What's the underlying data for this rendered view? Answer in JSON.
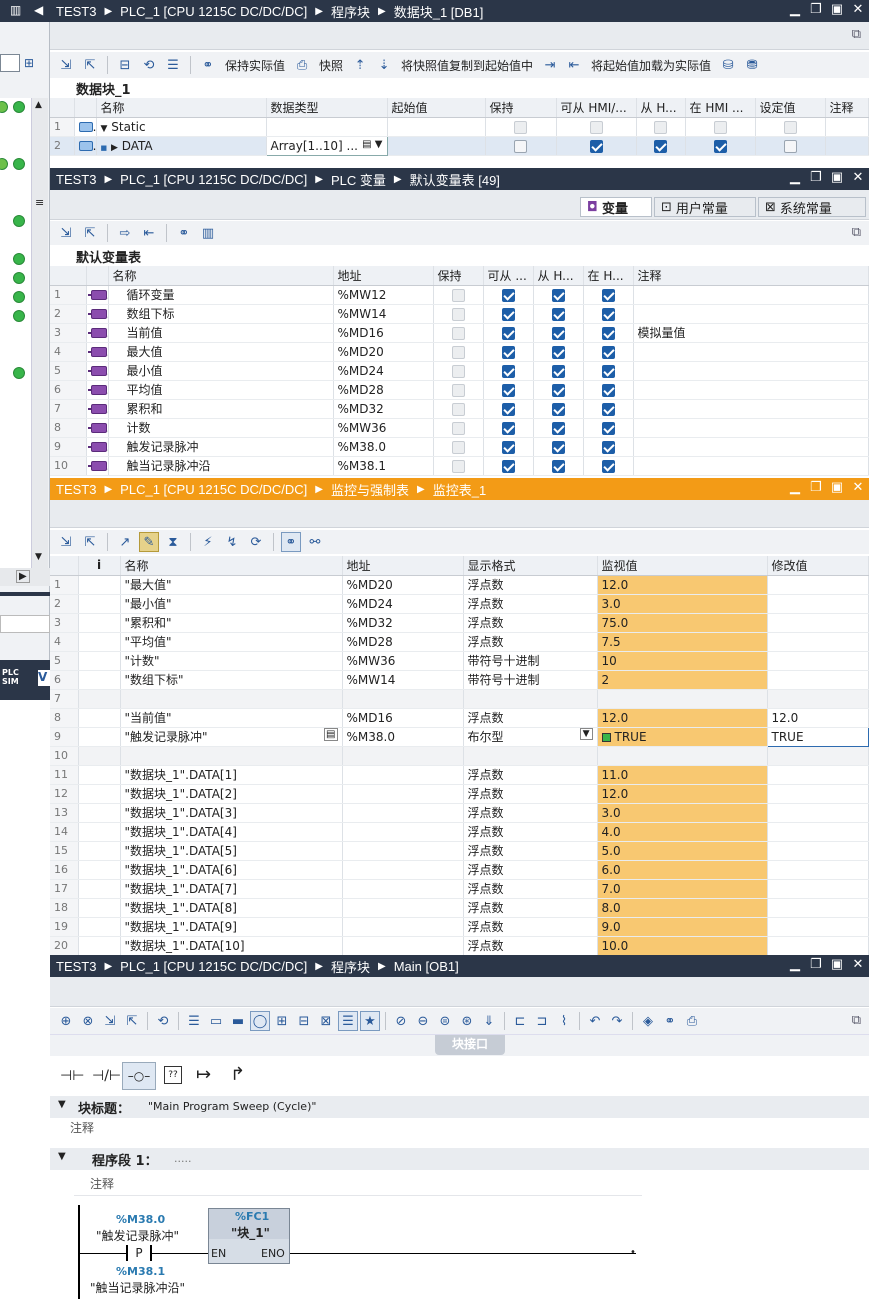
{
  "db_window": {
    "title": [
      "TEST3",
      "PLC_1 [CPU 1215C DC/DC/DC]",
      "程序块",
      "数据块_1 [DB1]"
    ],
    "toolbar": {
      "keep_actual": "保持实际值",
      "snapshot": "快照",
      "copy_snapshot": "将快照值复制到起始值中",
      "load_start": "将起始值加载为实际值"
    },
    "section": "数据块_1",
    "columns": [
      "名称",
      "数据类型",
      "起始值",
      "保持",
      "可从 HMI/...",
      "从 H...",
      "在 HMI ...",
      "设定值",
      "注释"
    ],
    "rows": [
      {
        "num": "1",
        "name": "Static",
        "type": "",
        "retain": false,
        "hmi": false,
        "from_h": false,
        "in_hmi": false,
        "setpoint": false,
        "dim": true
      },
      {
        "num": "2",
        "name": "DATA",
        "type": "Array[1..10] ...",
        "retain": false,
        "hmi": true,
        "from_h": true,
        "in_hmi": true,
        "setpoint": false,
        "dim": false
      }
    ]
  },
  "tag_window": {
    "title": [
      "TEST3",
      "PLC_1 [CPU 1215C DC/DC/DC]",
      "PLC 变量",
      "默认变量表 [49]"
    ],
    "tabs": [
      "变量",
      "用户常量",
      "系统常量"
    ],
    "section": "默认变量表",
    "columns": [
      "名称",
      "地址",
      "保持",
      "可从 ...",
      "从 H...",
      "在 H...",
      "注释"
    ],
    "rows": [
      {
        "num": "1",
        "name": "循环变量",
        "addr": "%MW12",
        "comment": ""
      },
      {
        "num": "2",
        "name": "数组下标",
        "addr": "%MW14",
        "comment": ""
      },
      {
        "num": "3",
        "name": "当前值",
        "addr": "%MD16",
        "comment": "模拟量值"
      },
      {
        "num": "4",
        "name": "最大值",
        "addr": "%MD20",
        "comment": ""
      },
      {
        "num": "5",
        "name": "最小值",
        "addr": "%MD24",
        "comment": ""
      },
      {
        "num": "6",
        "name": "平均值",
        "addr": "%MD28",
        "comment": ""
      },
      {
        "num": "7",
        "name": "累积和",
        "addr": "%MD32",
        "comment": ""
      },
      {
        "num": "8",
        "name": "计数",
        "addr": "%MW36",
        "comment": ""
      },
      {
        "num": "9",
        "name": "触发记录脉冲",
        "addr": "%M38.0",
        "comment": ""
      },
      {
        "num": "10",
        "name": "触当记录脉冲沿",
        "addr": "%M38.1",
        "comment": ""
      }
    ]
  },
  "watch_window": {
    "title": [
      "TEST3",
      "PLC_1 [CPU 1215C DC/DC/DC]",
      "监控与强制表",
      "监控表_1"
    ],
    "columns": [
      "i",
      "名称",
      "地址",
      "显示格式",
      "监视值",
      "修改值"
    ],
    "rows": [
      {
        "num": "1",
        "name": "\"最大值\"",
        "addr": "%MD20",
        "fmt": "浮点数",
        "mon": "12.0",
        "mod": ""
      },
      {
        "num": "2",
        "name": "\"最小值\"",
        "addr": "%MD24",
        "fmt": "浮点数",
        "mon": "3.0",
        "mod": ""
      },
      {
        "num": "3",
        "name": "\"累积和\"",
        "addr": "%MD32",
        "fmt": "浮点数",
        "mon": "75.0",
        "mod": ""
      },
      {
        "num": "4",
        "name": "\"平均值\"",
        "addr": "%MD28",
        "fmt": "浮点数",
        "mon": "7.5",
        "mod": ""
      },
      {
        "num": "5",
        "name": "\"计数\"",
        "addr": "%MW36",
        "fmt": "带符号十进制",
        "mon": "10",
        "mod": ""
      },
      {
        "num": "6",
        "name": "\"数组下标\"",
        "addr": "%MW14",
        "fmt": "带符号十进制",
        "mon": "2",
        "mod": ""
      },
      {
        "num": "7",
        "name": "",
        "addr": "",
        "fmt": "",
        "mon": "",
        "mod": ""
      },
      {
        "num": "8",
        "name": "\"当前值\"",
        "addr": "%MD16",
        "fmt": "浮点数",
        "mon": "12.0",
        "mod": "12.0"
      },
      {
        "num": "9",
        "name": "\"触发记录脉冲\"",
        "addr": "%M38.0",
        "fmt": "布尔型",
        "mon": "TRUE",
        "mod": "TRUE"
      },
      {
        "num": "10",
        "name": "",
        "addr": "",
        "fmt": "",
        "mon": "",
        "mod": ""
      },
      {
        "num": "11",
        "name": "\"数据块_1\".DATA[1]",
        "addr": "",
        "fmt": "浮点数",
        "mon": "11.0",
        "mod": ""
      },
      {
        "num": "12",
        "name": "\"数据块_1\".DATA[2]",
        "addr": "",
        "fmt": "浮点数",
        "mon": "12.0",
        "mod": ""
      },
      {
        "num": "13",
        "name": "\"数据块_1\".DATA[3]",
        "addr": "",
        "fmt": "浮点数",
        "mon": "3.0",
        "mod": ""
      },
      {
        "num": "14",
        "name": "\"数据块_1\".DATA[4]",
        "addr": "",
        "fmt": "浮点数",
        "mon": "4.0",
        "mod": ""
      },
      {
        "num": "15",
        "name": "\"数据块_1\".DATA[5]",
        "addr": "",
        "fmt": "浮点数",
        "mon": "5.0",
        "mod": ""
      },
      {
        "num": "16",
        "name": "\"数据块_1\".DATA[6]",
        "addr": "",
        "fmt": "浮点数",
        "mon": "6.0",
        "mod": ""
      },
      {
        "num": "17",
        "name": "\"数据块_1\".DATA[7]",
        "addr": "",
        "fmt": "浮点数",
        "mon": "7.0",
        "mod": ""
      },
      {
        "num": "18",
        "name": "\"数据块_1\".DATA[8]",
        "addr": "",
        "fmt": "浮点数",
        "mon": "8.0",
        "mod": ""
      },
      {
        "num": "19",
        "name": "\"数据块_1\".DATA[9]",
        "addr": "",
        "fmt": "浮点数",
        "mon": "9.0",
        "mod": ""
      },
      {
        "num": "20",
        "name": "\"数据块_1\".DATA[10]",
        "addr": "",
        "fmt": "浮点数",
        "mon": "10.0",
        "mod": ""
      }
    ]
  },
  "ob_window": {
    "title": [
      "TEST3",
      "PLC_1 [CPU 1215C DC/DC/DC]",
      "程序块",
      "Main [OB1]"
    ],
    "block_interface": "块接口",
    "block_title_label": "块标题：",
    "block_title_value": "\"Main Program Sweep (Cycle)\"",
    "comment": "注释",
    "network_label": "程序段 1：",
    "network_dots": ".....",
    "network_comment": "注释",
    "contact1_addr": "%M38.0",
    "contact1_name": "\"触发记录脉冲\"",
    "contact1_sym": "P",
    "contact2_addr": "%M38.1",
    "contact2_name": "\"触当记录脉冲沿\"",
    "fc_addr": "%FC1",
    "fc_name": "\"块_1\"",
    "fc_en": "EN",
    "fc_eno": "ENO"
  },
  "left_panel": {
    "plcsim": "PLC SIM"
  },
  "colors": {
    "titlebar": "#2b3648",
    "active_titlebar": "#f39b16",
    "monitor_cell": "#f8c871",
    "status_ok": "#38b54a"
  }
}
